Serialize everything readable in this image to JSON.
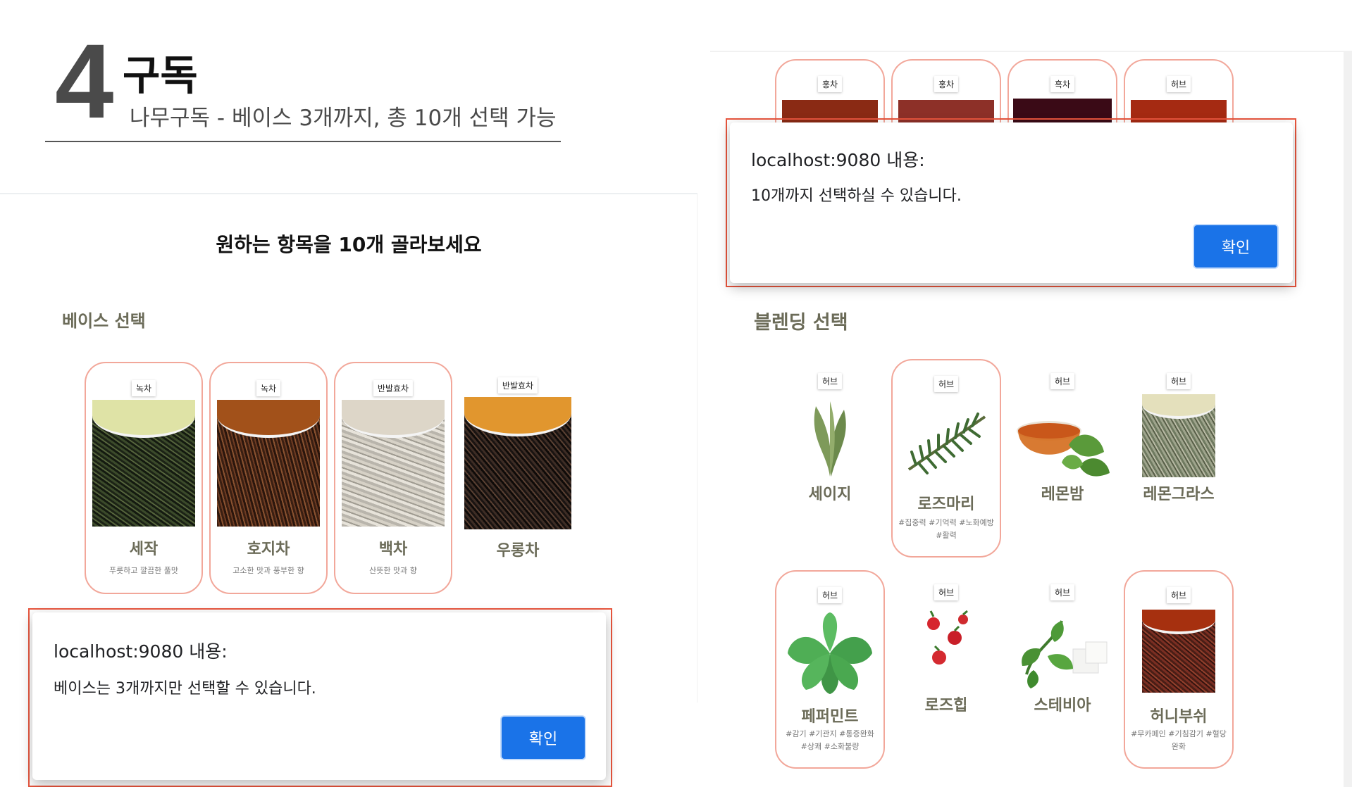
{
  "heading": {
    "number": "4",
    "title": "구독",
    "subtitle": "나무구독  -  베이스 3개까지, 총 10개 선택 가능"
  },
  "left": {
    "main_heading": "원하는 항목을 10개 골라보세요",
    "section_label": "베이스 선택",
    "base_cards": [
      {
        "tag": "녹차",
        "name": "세작",
        "desc": "푸릇하고 깔끔한 풀맛",
        "selected": true
      },
      {
        "tag": "녹차",
        "name": "호지차",
        "desc": "고소한 맛과 풍부한 향",
        "selected": true
      },
      {
        "tag": "반발효차",
        "name": "백차",
        "desc": "산뜻한 맛과 향",
        "selected": true
      },
      {
        "tag": "반발효차",
        "name": "우롱차",
        "desc": "",
        "selected": false
      }
    ],
    "alert": {
      "title": "localhost:9080 내용:",
      "message": "베이스는 3개까지만 선택할 수 있습니다.",
      "button": "확인"
    }
  },
  "right": {
    "top_cards": [
      {
        "tag": "홍차",
        "selected": true
      },
      {
        "tag": "홍차",
        "selected": true
      },
      {
        "tag": "흑차",
        "selected": true
      },
      {
        "tag": "허브",
        "selected": true
      }
    ],
    "alert": {
      "title": "localhost:9080 내용:",
      "message": "10개까지 선택하실 수 있습니다.",
      "button": "확인"
    },
    "section_label": "블렌딩 선택",
    "blend_cards": [
      {
        "tag": "허브",
        "name": "세이지",
        "desc": "",
        "selected": false
      },
      {
        "tag": "허브",
        "name": "로즈마리",
        "desc": "#집중력 #기억력 #노화예방 #활력",
        "selected": true
      },
      {
        "tag": "허브",
        "name": "레몬밤",
        "desc": "",
        "selected": false
      },
      {
        "tag": "허브",
        "name": "레몬그라스",
        "desc": "",
        "selected": false
      },
      {
        "tag": "허브",
        "name": "페퍼민트",
        "desc": "#감기 #기관지 #통증완화 #상쾌 #소화불량",
        "selected": true
      },
      {
        "tag": "허브",
        "name": "로즈힙",
        "desc": "",
        "selected": false
      },
      {
        "tag": "허브",
        "name": "스테비아",
        "desc": "",
        "selected": false
      },
      {
        "tag": "허브",
        "name": "허니부쉬",
        "desc": "#무카페인 #기침감기 #혈당완화",
        "selected": true
      }
    ]
  }
}
